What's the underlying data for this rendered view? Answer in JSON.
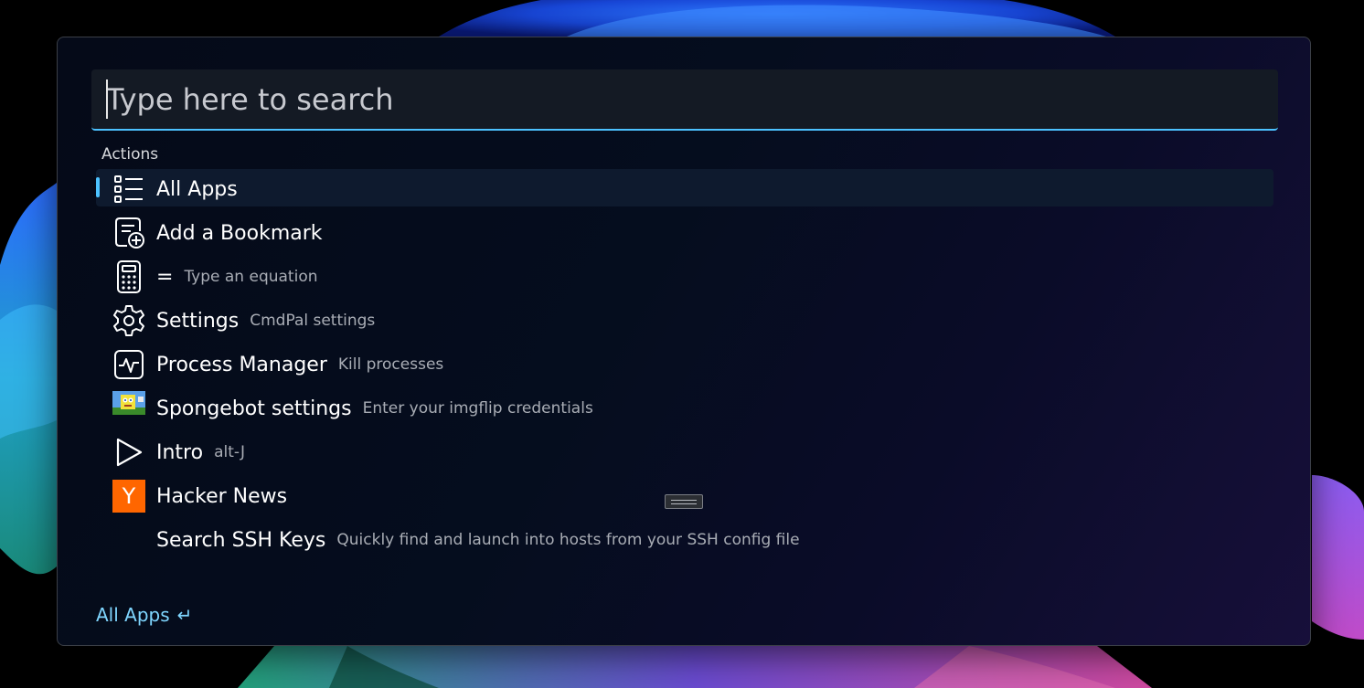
{
  "search": {
    "placeholder": "Type here to search",
    "value": ""
  },
  "section": {
    "label": "Actions"
  },
  "items": [
    {
      "title": "All Apps",
      "subtitle": "",
      "icon": "list-icon",
      "selected": true
    },
    {
      "title": "Add a Bookmark",
      "subtitle": "",
      "icon": "bookmark-add-icon",
      "selected": false
    },
    {
      "title": "=",
      "subtitle": "Type an equation",
      "icon": "calculator-icon",
      "selected": false
    },
    {
      "title": "Settings",
      "subtitle": "CmdPal settings",
      "icon": "gear-icon",
      "selected": false
    },
    {
      "title": "Process Manager",
      "subtitle": "Kill processes",
      "icon": "activity-icon",
      "selected": false
    },
    {
      "title": "Spongebot settings",
      "subtitle": "Enter your imgflip credentials",
      "icon": "spongebob-image-icon",
      "selected": false
    },
    {
      "title": "Intro",
      "subtitle": "alt-J",
      "icon": "play-icon",
      "selected": false
    },
    {
      "title": "Hacker News",
      "subtitle": "",
      "icon": "hacker-news-icon",
      "hn_letter": "Y",
      "selected": false
    },
    {
      "title": "Search SSH Keys",
      "subtitle": "Quickly find and launch into hosts from your SSH config file",
      "icon": "",
      "selected": false
    }
  ],
  "footer": {
    "primary_action": "All Apps",
    "enter_glyph": "↵"
  },
  "colors": {
    "accent": "#4cc2ff",
    "hn_orange": "#ff6600",
    "footer_text": "#7fd6ff"
  }
}
